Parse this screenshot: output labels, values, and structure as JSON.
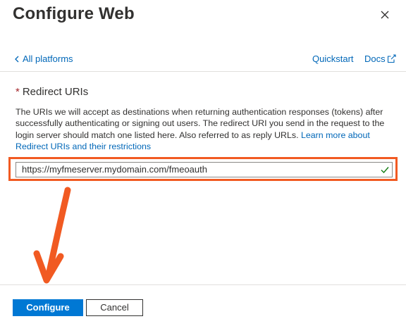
{
  "panel": {
    "title": "Configure Web",
    "close_icon": "close-icon"
  },
  "nav": {
    "back_label": "All platforms",
    "back_icon": "chevron-left-icon",
    "quickstart_label": "Quickstart",
    "docs_label": "Docs",
    "docs_icon": "external-link-icon"
  },
  "redirect": {
    "required_marker": "*",
    "label": "Redirect URIs",
    "description": "The URIs we will accept as destinations when returning authentication responses (tokens) after successfully authenticating or signing out users. The redirect URI you send in the request to the login server should match one listed here. Also referred to as reply URLs.",
    "learn_more": "Learn more about Redirect URIs and their restrictions",
    "uri_value": "https://myfmeserver.mydomain.com/fmeoauth",
    "valid_icon": "checkmark-icon"
  },
  "footer": {
    "configure_label": "Configure",
    "cancel_label": "Cancel"
  },
  "colors": {
    "accent": "#0078d4",
    "link": "#0067b8",
    "annotation": "#f15a22",
    "required": "#a4262c",
    "valid": "#107c10"
  }
}
